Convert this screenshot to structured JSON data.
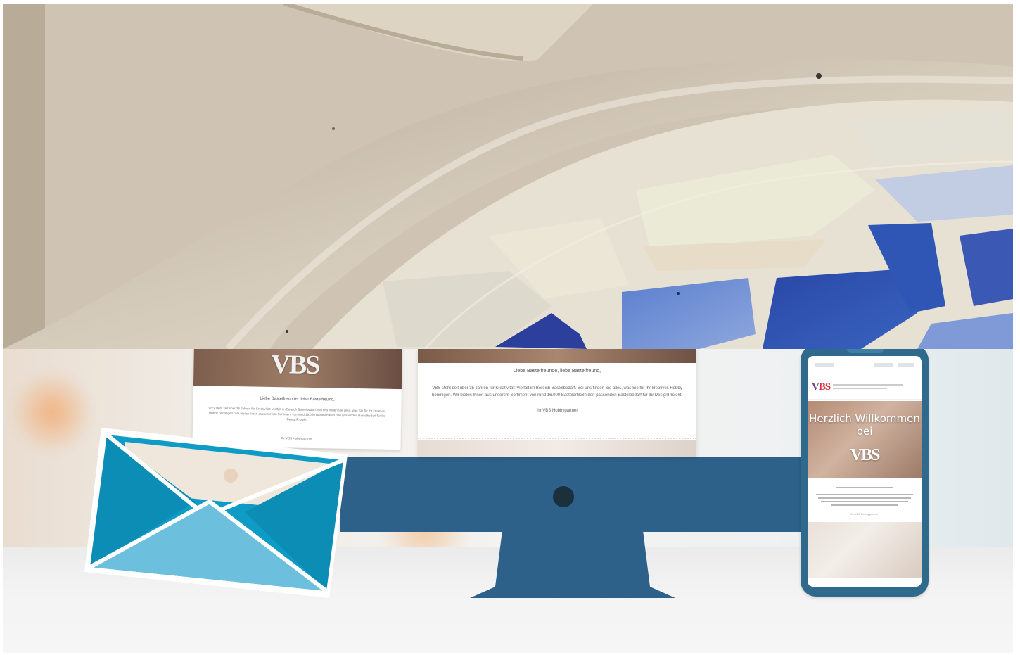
{
  "hero": {
    "icon": "mosaic-stone-photo",
    "colors": {
      "stone": "#d9cfbf",
      "tile_blue": "#2d4fa8",
      "tile_pale": "#e9e4d6"
    }
  },
  "scene": {
    "colors": {
      "monitor": "#2e6189",
      "envelope": "#0e9bc5",
      "envelope_light": "#6cc0de",
      "phone": "#2f6a8c"
    }
  },
  "desktop_mail": {
    "greeting": "Liebe Bastelfreunde, liebe Bastelfreund,",
    "body": "VBS steht seit über 35 Jahren für Kreativität: Vielfalt im Bereich Bastelbedarf. Bei uns finden Sie alles, was Sie für Ihr kreatives Hobby benötigen. Wir bieten Ihnen aus unserem Sortiment von rund 16.000 Bastelartikeln den passenden Bastelbedarf für Ihr DesignProjekt.",
    "signature": "Ihr VBS Hobbypartner"
  },
  "envelope_mail": {
    "logo": "VBS",
    "greeting": "Liebe Bastelfreunde, liebe Bastelfreund,",
    "body": "VBS steht seit über 35 Jahren für Kreativität: Vielfalt im Bereich Bastelbedarf. Bei uns finden Sie alles, was Sie für Ihr kreatives Hobby benötigen. Wir bieten Ihnen aus unserem Sortiment von rund 16.000 Bastelartikeln den passenden Bastelbedarf für Ihr DesignProjekt.",
    "signature": "Ihr VBS Hobbypartner"
  },
  "phone_mail": {
    "logo_v": "V",
    "logo_bs": "BS",
    "hero_title": "Herzlich Willkommen bei",
    "hero_logo": "VBS",
    "signature": "Ihr VBS Hobbypartner"
  }
}
